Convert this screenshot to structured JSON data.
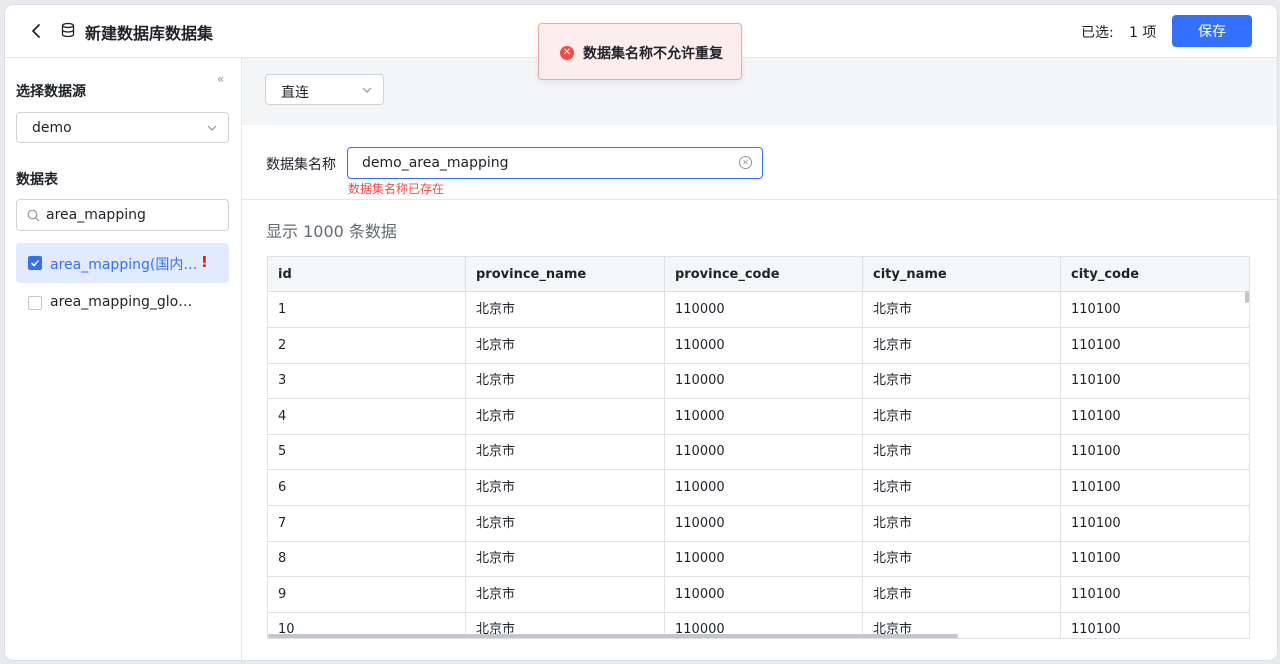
{
  "header": {
    "title": "新建数据库数据集",
    "selected_label": "已选:",
    "selected_count": "1 项",
    "save_label": "保存"
  },
  "toast": {
    "message": "数据集名称不允许重复",
    "icon": "error-circle-icon",
    "color": "#f54a45"
  },
  "sidebar": {
    "datasource_heading": "选择数据源",
    "datasource_value": "demo",
    "tables_heading": "数据表",
    "search_value": "area_mapping",
    "items": [
      {
        "label": "area_mapping(国内省...",
        "checked": true,
        "warning": "!"
      },
      {
        "label": "area_mapping_global(...",
        "checked": false
      }
    ]
  },
  "main": {
    "mode_value": "直连",
    "name_label": "数据集名称",
    "name_value": "demo_area_mapping",
    "name_error": "数据集名称已存在",
    "preview_count": "显示  1000  条数据",
    "columns": [
      "id",
      "province_name",
      "province_code",
      "city_name",
      "city_code"
    ],
    "rows": [
      [
        "1",
        "北京市",
        "110000",
        "北京市",
        "110100"
      ],
      [
        "2",
        "北京市",
        "110000",
        "北京市",
        "110100"
      ],
      [
        "3",
        "北京市",
        "110000",
        "北京市",
        "110100"
      ],
      [
        "4",
        "北京市",
        "110000",
        "北京市",
        "110100"
      ],
      [
        "5",
        "北京市",
        "110000",
        "北京市",
        "110100"
      ],
      [
        "6",
        "北京市",
        "110000",
        "北京市",
        "110100"
      ],
      [
        "7",
        "北京市",
        "110000",
        "北京市",
        "110100"
      ],
      [
        "8",
        "北京市",
        "110000",
        "北京市",
        "110100"
      ],
      [
        "9",
        "北京市",
        "110000",
        "北京市",
        "110100"
      ],
      [
        "10",
        "北京市",
        "110000",
        "北京市",
        "110100"
      ]
    ]
  },
  "colors": {
    "primary": "#3370ff",
    "error": "#f54a45",
    "warning": "#d81e06"
  }
}
